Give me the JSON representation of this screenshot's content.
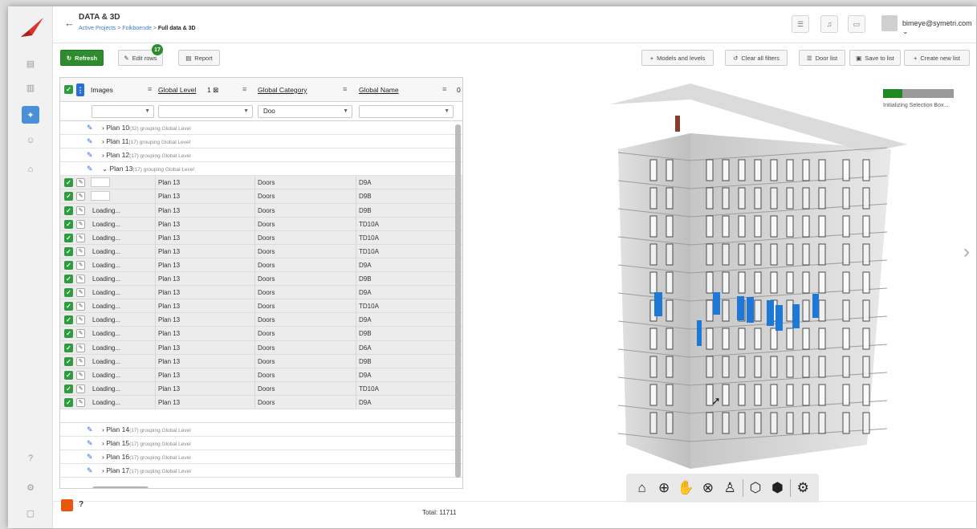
{
  "header": {
    "back": "←",
    "title": "DATA & 3D",
    "breadcrumb": [
      "Active Projects",
      "Folkboende",
      "Full data & 3D"
    ],
    "crumb_sep": ">",
    "user": "bimeye@symetri.com",
    "user_caret": "⌄"
  },
  "toolbar": {
    "refresh": "Refresh",
    "edit_rows": "Edit rows",
    "edit_badge": "17",
    "report": "Report",
    "models_levels": "Models and levels",
    "clear_filters": "Clear all filters",
    "door_list": "Door list",
    "save_list": "Save to list",
    "create_list": "Create new list"
  },
  "table": {
    "columns": [
      "Images",
      "Global Level",
      "Global Category",
      "Global Name"
    ],
    "level_sort": "1",
    "more_col": "0",
    "filters": [
      "",
      "",
      "Doo",
      ""
    ],
    "groups_before": [
      {
        "label": "Plan 10",
        "count": "(32) grouping Global Level"
      },
      {
        "label": "Plan 11",
        "count": "(17) grouping Global Level"
      },
      {
        "label": "Plan 12",
        "count": "(17) grouping Global Level"
      },
      {
        "label": "Plan 13",
        "count": "(17) grouping Global Level"
      }
    ],
    "rows": [
      {
        "image": "",
        "level": "Plan 13",
        "category": "Doors",
        "name": "D9A"
      },
      {
        "image": "",
        "level": "Plan 13",
        "category": "Doors",
        "name": "D9B"
      },
      {
        "image": "Loading...",
        "level": "Plan 13",
        "category": "Doors",
        "name": "D9B"
      },
      {
        "image": "Loading...",
        "level": "Plan 13",
        "category": "Doors",
        "name": "TD10A"
      },
      {
        "image": "Loading...",
        "level": "Plan 13",
        "category": "Doors",
        "name": "TD10A"
      },
      {
        "image": "Loading...",
        "level": "Plan 13",
        "category": "Doors",
        "name": "TD10A"
      },
      {
        "image": "Loading...",
        "level": "Plan 13",
        "category": "Doors",
        "name": "D9A"
      },
      {
        "image": "Loading...",
        "level": "Plan 13",
        "category": "Doors",
        "name": "D9B"
      },
      {
        "image": "Loading...",
        "level": "Plan 13",
        "category": "Doors",
        "name": "D9A"
      },
      {
        "image": "Loading...",
        "level": "Plan 13",
        "category": "Doors",
        "name": "TD10A"
      },
      {
        "image": "Loading...",
        "level": "Plan 13",
        "category": "Doors",
        "name": "D9A"
      },
      {
        "image": "Loading...",
        "level": "Plan 13",
        "category": "Doors",
        "name": "D9B"
      },
      {
        "image": "Loading...",
        "level": "Plan 13",
        "category": "Doors",
        "name": "D6A"
      },
      {
        "image": "Loading...",
        "level": "Plan 13",
        "category": "Doors",
        "name": "D9B"
      },
      {
        "image": "Loading...",
        "level": "Plan 13",
        "category": "Doors",
        "name": "D9A"
      },
      {
        "image": "Loading...",
        "level": "Plan 13",
        "category": "Doors",
        "name": "TD10A"
      },
      {
        "image": "Loading...",
        "level": "Plan 13",
        "category": "Doors",
        "name": "D9A"
      }
    ],
    "groups_after": [
      {
        "label": "Plan 14",
        "count": "(17) grouping Global Level"
      },
      {
        "label": "Plan 15",
        "count": "(17) grouping Global Level"
      },
      {
        "label": "Plan 16",
        "count": "(17) grouping Global Level"
      },
      {
        "label": "Plan 17",
        "count": "(17) grouping Global Level"
      }
    ]
  },
  "footer": {
    "help": "?",
    "total": "Total: 11711"
  },
  "viewer": {
    "init_text": "Initializing Selection Box...",
    "init_progress": 0.27,
    "nav_icons": [
      "home-icon",
      "globe-icon",
      "pan-hand-icon",
      "zoom-icon",
      "person-icon",
      "section-box-icon",
      "cube-icon",
      "settings-icon"
    ]
  },
  "colors": {
    "accent_green": "#2e8b2e",
    "accent_blue": "#2b6fd6",
    "selected_door": "#1e78d6",
    "brand_orange": "#e8580c"
  }
}
